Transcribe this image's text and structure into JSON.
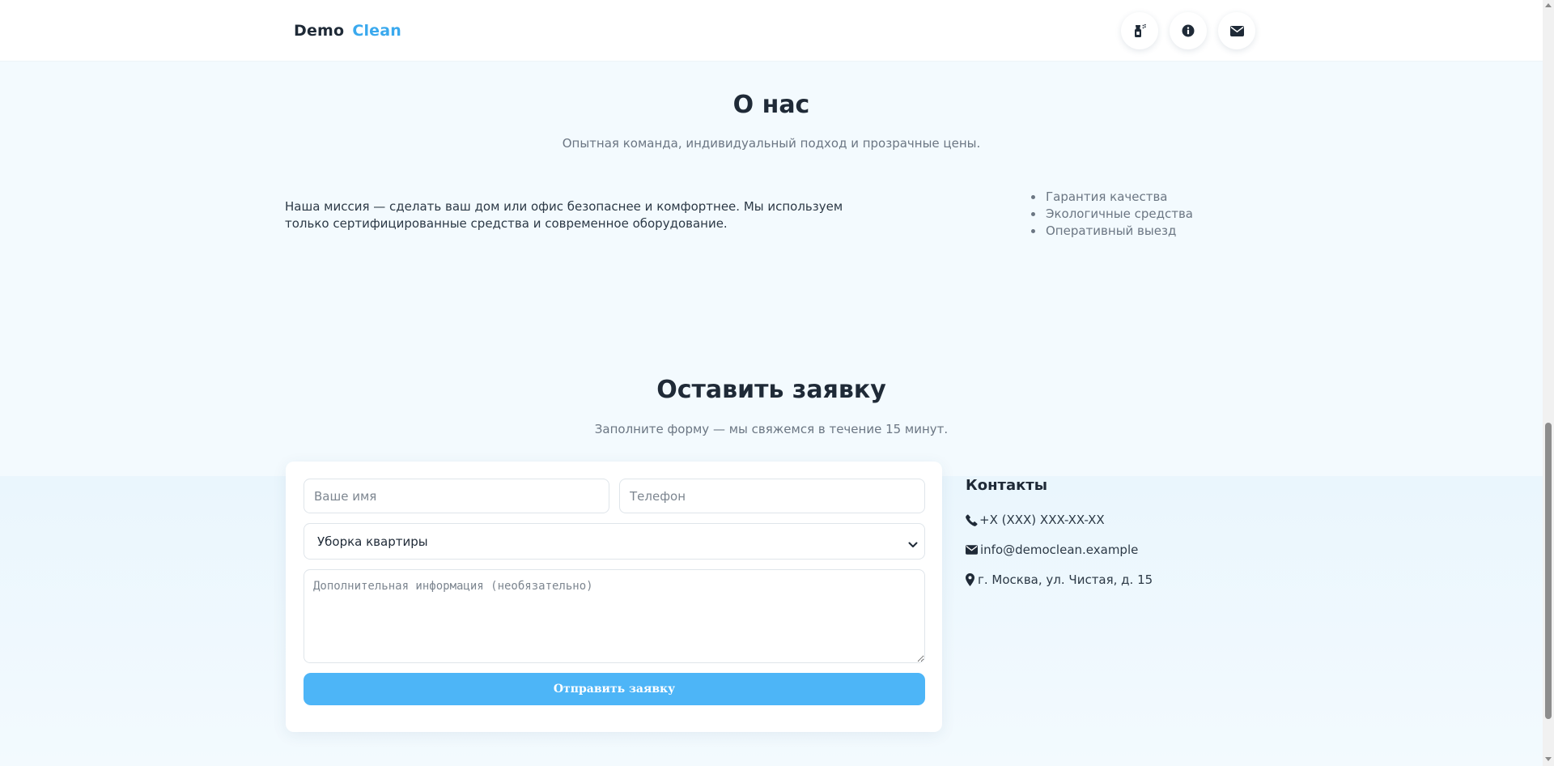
{
  "header": {
    "brand_part1": "Demo",
    "brand_part2": "Clean",
    "brand_accent_color": "#3aa9ee",
    "icons": [
      "spray-bottle-icon",
      "info-icon",
      "envelope-icon"
    ]
  },
  "about": {
    "title": "О нас",
    "subtitle": "Опытная команда, индивидуальный подход и прозрачные цены.",
    "mission": "Наша миссия — сделать ваш дом или офис безопаснее и комфортнее. Мы используем только сертифицированные средства и современное оборудование.",
    "features": [
      "Гарантия качества",
      "Экологичные средства",
      "Оперативный выезд"
    ]
  },
  "request": {
    "title": "Оставить заявку",
    "subtitle": "Заполните форму — мы свяжемся в течение 15 минут.",
    "form": {
      "name_placeholder": "Ваше имя",
      "name_value": "",
      "phone_placeholder": "Телефон",
      "phone_value": "",
      "service_selected": "Уборка квартиры",
      "comment_placeholder": "Дополнительная информация (необязательно)",
      "comment_value": "",
      "submit_label": "Отправить заявку",
      "submit_color": "#4db5f7"
    }
  },
  "contacts": {
    "title": "Контакты",
    "phone": "+X (XXX) XXX-XX-XX",
    "email": "info@democlean.example",
    "address": "г. Москва, ул. Чистая, д. 15"
  }
}
